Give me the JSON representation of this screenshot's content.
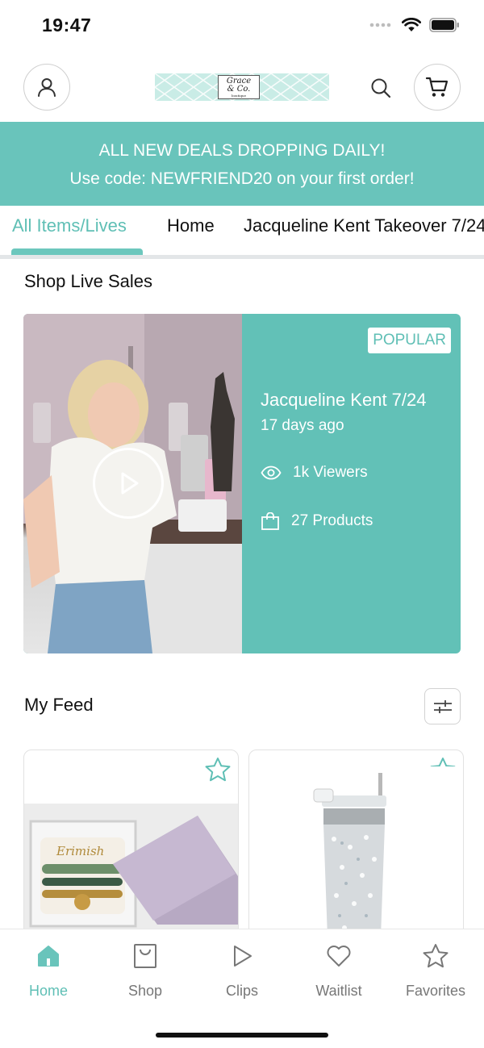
{
  "status_bar": {
    "time": "19:47"
  },
  "header": {
    "logo": {
      "line1": "Grace",
      "line2": "& Co.",
      "sub": "boutique"
    },
    "icons": [
      "user-icon",
      "search-icon",
      "cart-icon"
    ]
  },
  "banner": {
    "line1": "ALL NEW DEALS DROPPING DAILY!",
    "line2": "Use code: NEWFRIEND20 on your first order!"
  },
  "tabs": [
    {
      "label": "All Items/Lives",
      "active": true
    },
    {
      "label": "Home",
      "active": false
    },
    {
      "label": "Jacqueline Kent Takeover 7/24",
      "active": false
    }
  ],
  "live_sales": {
    "title": "Shop Live Sales",
    "card": {
      "badge": "POPULAR",
      "title": "Jacqueline Kent 7/24",
      "time_ago": "17 days ago",
      "viewers": "1k Viewers",
      "products": "27 Products"
    }
  },
  "feed": {
    "title": "My Feed",
    "items": [
      {
        "image": "bracelet-set-box",
        "brand_text": "Erimish"
      },
      {
        "image": "rhinestone-tumbler"
      }
    ]
  },
  "bottom_nav": [
    {
      "label": "Home",
      "icon": "home-icon",
      "active": true
    },
    {
      "label": "Shop",
      "icon": "shopping-bag-icon",
      "active": false
    },
    {
      "label": "Clips",
      "icon": "play-icon",
      "active": false
    },
    {
      "label": "Waitlist",
      "icon": "heart-icon",
      "active": false
    },
    {
      "label": "Favorites",
      "icon": "star-icon",
      "active": false
    }
  ],
  "colors": {
    "accent": "#69c4bb",
    "accent_text": "#5fbfb5",
    "card": "#62c1b7",
    "inactive": "#777777"
  }
}
